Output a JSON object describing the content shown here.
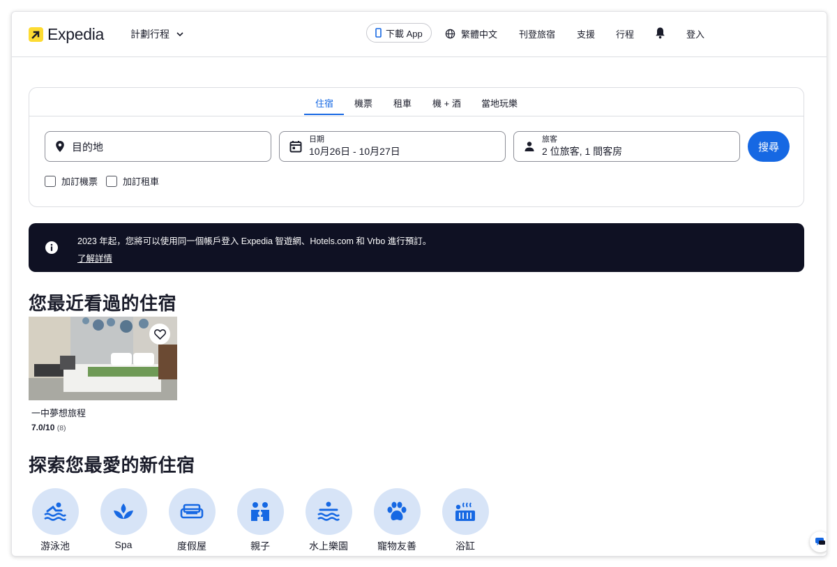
{
  "header": {
    "brand": "Expedia",
    "plan_trip": "計劃行程",
    "download_app": "下載 App",
    "language": "繁體中文",
    "list_property": "刊登旅宿",
    "support": "支援",
    "trips": "行程",
    "sign_in": "登入"
  },
  "search": {
    "tabs": [
      "住宿",
      "機票",
      "租車",
      "機 + 酒",
      "當地玩樂"
    ],
    "active_tab": "住宿",
    "destination_placeholder": "目的地",
    "date_label": "日期",
    "date_value": "10月26日 - 10月27日",
    "travelers_label": "旅客",
    "travelers_value": "2 位旅客, 1 間客房",
    "search_button": "搜尋",
    "add_flight": "加訂機票",
    "add_car": "加訂租車"
  },
  "banner": {
    "message": "2023 年起，您將可以使用同一個帳戶登入 Expedia 智遊網、Hotels.com 和 Vrbo 進行預訂。",
    "link": "了解詳情"
  },
  "recent": {
    "heading": "您最近看過的住宿",
    "items": [
      {
        "name": "一中夢想旅程",
        "score": "7.0/10",
        "reviews": "(8)"
      }
    ]
  },
  "explore": {
    "heading": "探索您最愛的新住宿",
    "categories": [
      {
        "label": "游泳池",
        "icon": "pool-icon"
      },
      {
        "label": "Spa",
        "icon": "spa-icon"
      },
      {
        "label": "度假屋",
        "icon": "sofa-icon"
      },
      {
        "label": "親子",
        "icon": "family-icon"
      },
      {
        "label": "水上樂園",
        "icon": "water-park-icon"
      },
      {
        "label": "寵物友善",
        "icon": "paw-icon"
      },
      {
        "label": "浴缸",
        "icon": "hot-tub-icon"
      }
    ]
  },
  "colors": {
    "primary": "#1668e3",
    "brand_yellow": "#fddb32",
    "banner_bg": "#0f1123",
    "category_bg": "#d7e4f7"
  }
}
